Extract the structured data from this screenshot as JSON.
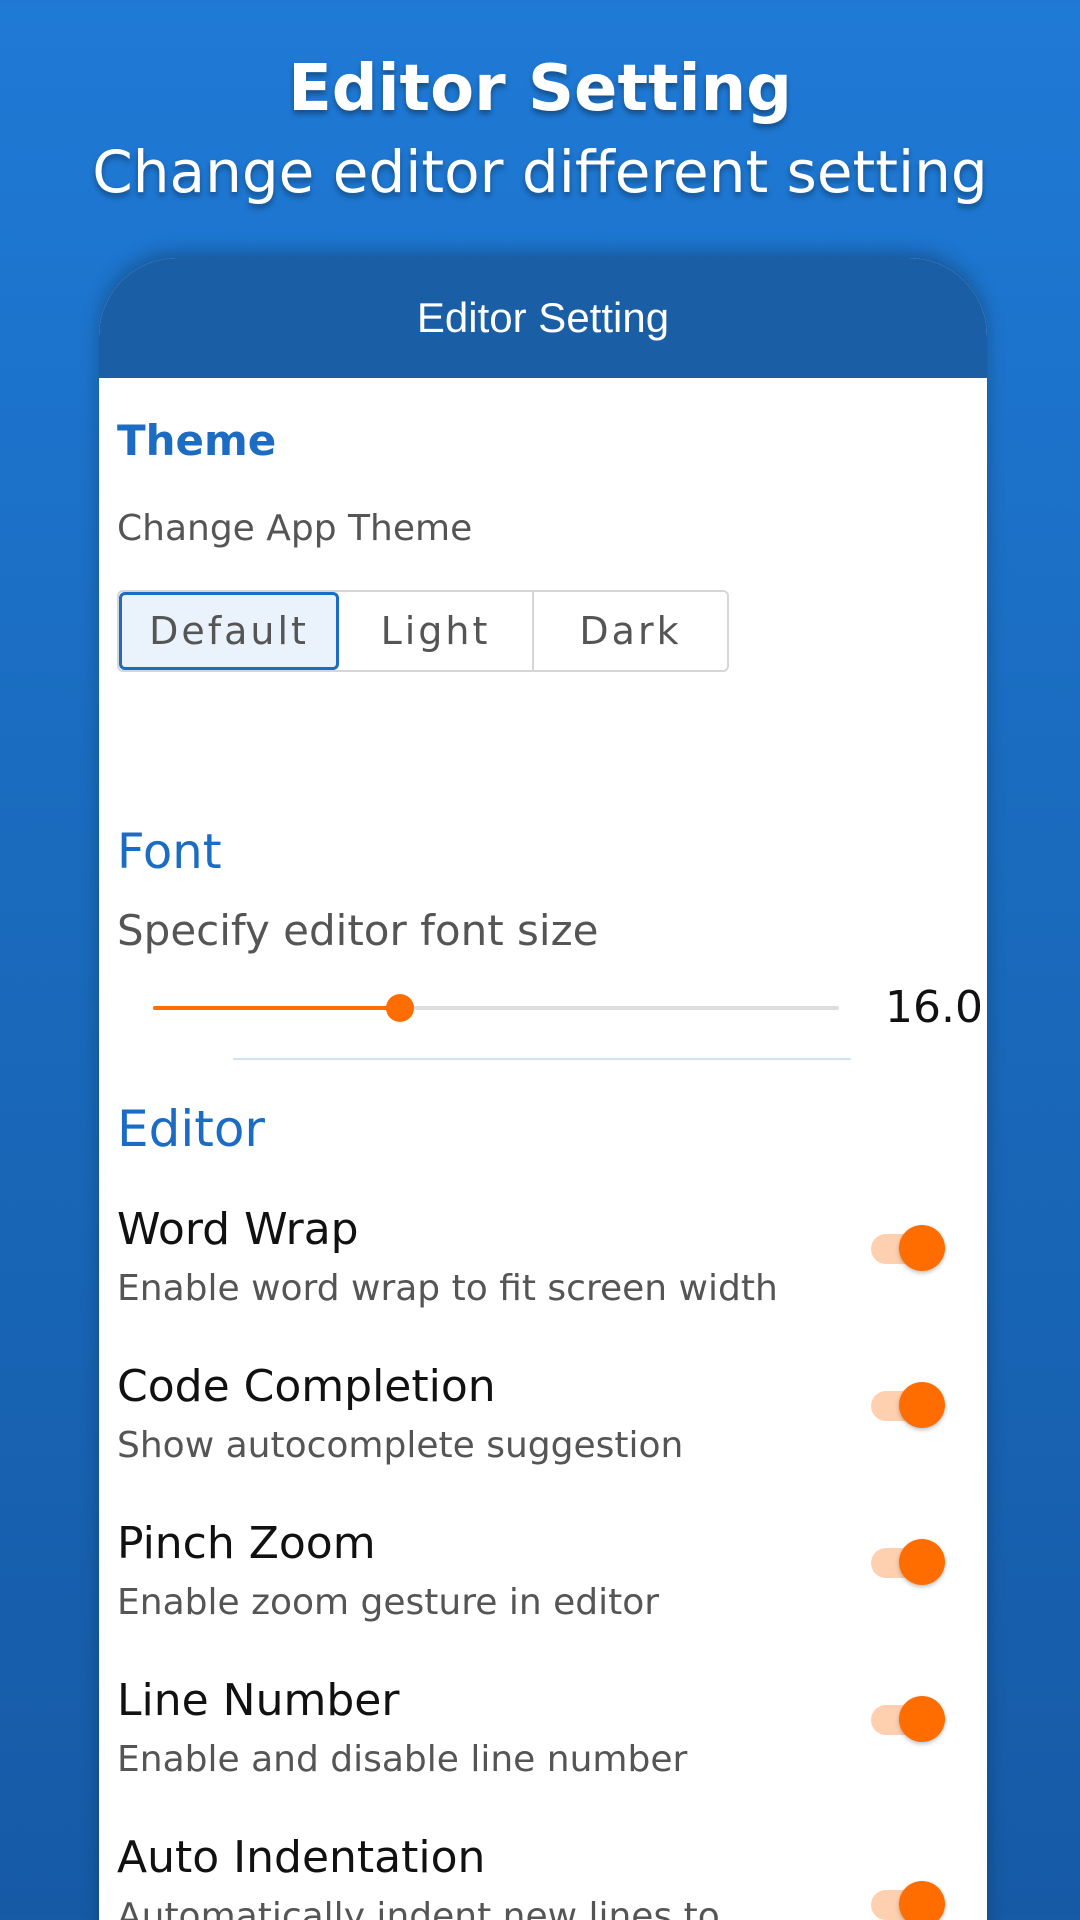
{
  "hero": {
    "title": "Editor Setting",
    "subtitle": "Change editor different setting"
  },
  "appbar": {
    "title": "Editor Setting"
  },
  "theme": {
    "section_label": "Theme",
    "caption": "Change App Theme",
    "options": [
      "Default",
      "Light",
      "Dark"
    ],
    "selected": "Default"
  },
  "font": {
    "section_label": "Font",
    "caption": "Specify editor font size",
    "slider_value": "16.0",
    "slider_fraction": 0.36
  },
  "editor": {
    "section_label": "Editor",
    "settings": [
      {
        "title": "Word Wrap",
        "desc": "Enable word wrap to fit screen width",
        "enabled": true
      },
      {
        "title": "Code Completion",
        "desc": "Show autocomplete suggestion",
        "enabled": true
      },
      {
        "title": "Pinch Zoom",
        "desc": "Enable zoom gesture in editor",
        "enabled": true
      },
      {
        "title": "Line Number",
        "desc": "Enable and disable line number",
        "enabled": true
      },
      {
        "title": "Auto Indentation",
        "desc": "Automatically indent new lines to match the line above",
        "enabled": true
      }
    ]
  },
  "colors": {
    "accent": "#ff6d00",
    "primary": "#1b6cc2",
    "appbar": "#1a5fa6"
  }
}
